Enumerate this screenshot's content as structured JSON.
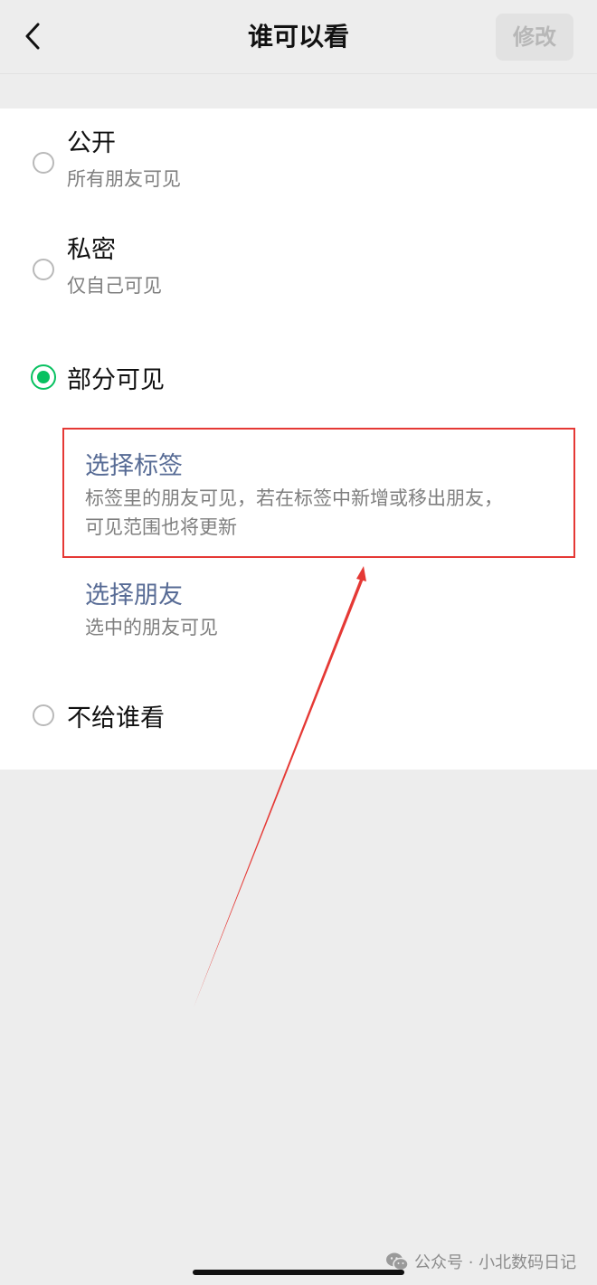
{
  "nav": {
    "title": "谁可以看",
    "modify_label": "修改"
  },
  "options": [
    {
      "title": "公开",
      "desc": "所有朋友可见",
      "selected": false
    },
    {
      "title": "私密",
      "desc": "仅自己可见",
      "selected": false
    },
    {
      "title": "部分可见",
      "selected": true
    },
    {
      "title": "不给谁看",
      "selected": false
    }
  ],
  "partial_sub": {
    "select_tag": {
      "title": "选择标签",
      "desc_line1": "标签里的朋友可见，若在标签中新增或移出朋友，",
      "desc_line2": "可见范围也将更新"
    },
    "select_friends": {
      "title": "选择朋友",
      "desc": "选中的朋友可见"
    }
  },
  "watermark": {
    "text": "公众号 · 小北数码日记"
  },
  "colors": {
    "accent_green": "#07c160",
    "link_blue": "#576b95",
    "annotation_red": "#e53935",
    "page_bg": "#ededed"
  },
  "icons": {
    "back": "chevron-left-icon",
    "watermark": "wechat-icon"
  }
}
